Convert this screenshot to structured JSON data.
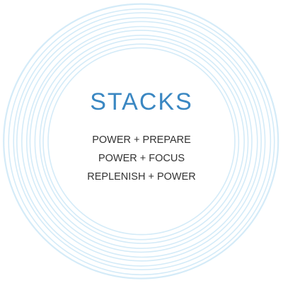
{
  "colors": {
    "title": "#3a87c2",
    "ring": "#d4ebf8",
    "background": "#ffffff"
  },
  "stacks": {
    "title": "STACKS",
    "items": [
      "POWER + PREPARE",
      "POWER + FOCUS",
      "REPLENISH + POWER"
    ]
  }
}
